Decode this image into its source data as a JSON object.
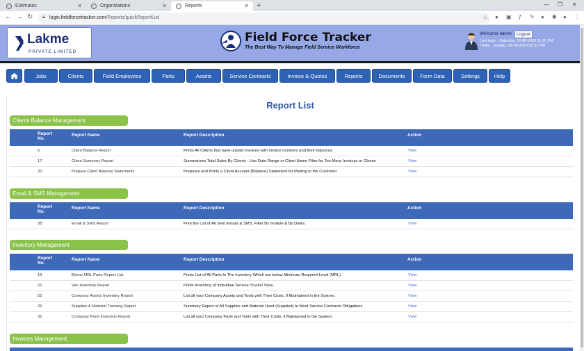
{
  "browser": {
    "tabs": [
      {
        "label": "Estimates",
        "active": false
      },
      {
        "label": "Organizations",
        "active": false
      },
      {
        "label": "Reports",
        "active": true
      }
    ],
    "new_tab": "+",
    "url_host": "login.fieldforcetracker.com",
    "url_path": "/Reports/quickReportList"
  },
  "header": {
    "logo_name": "Lakme",
    "logo_sub": "PRIVATE LIMITED",
    "brand_title": "Field Force Tracker",
    "brand_tagline": "The Best Way To Manage Field Service Workforce",
    "welcome": "Welcome lakme",
    "logout": "Logout",
    "last_login": "Last login : Saturday, 08-08-2020 11:10 PM",
    "today": "Today : Sunday, 08-09-2020 06:51 PM"
  },
  "nav": {
    "items": [
      "Jobs",
      "Clients",
      "Field Employees",
      "Parts",
      "Assets",
      "Service Contracts",
      "Invoice & Quotes",
      "Reports",
      "Documents",
      "Form Data",
      "Settings",
      "Help"
    ]
  },
  "page": {
    "title": "Report List",
    "columns": {
      "no": "Report No.",
      "name": "Report Name",
      "desc": "Report Description",
      "action": "Action"
    },
    "view_label": "View"
  },
  "sections": [
    {
      "title": "Clients Balance Management",
      "rows": [
        {
          "no": "6",
          "name": "Client Balance Report",
          "desc": "Prints All Clients that have unpaid invoices with invoice numbers and their balances."
        },
        {
          "no": "17",
          "name": "Client Summary Report",
          "desc": "Summarizes Total Sales By Clients - Use Date Range or Client Name Filter for Too Many Invoices or Clients"
        },
        {
          "no": "20",
          "name": "Prepare Client Balance Statements",
          "desc": "Prepares and Prints a Client Account (Balance) Statement for Mailing to the Customer."
        }
      ]
    },
    {
      "title": "Email & SMS Management",
      "rows": [
        {
          "no": "38",
          "name": "Email & SMS Report",
          "desc": "Print the List of All Sent Emails & SMS. Filter By module & By Dates."
        }
      ]
    },
    {
      "title": "Inventory Management",
      "rows": [
        {
          "no": "19",
          "name": "Below MRL Parts Report List",
          "desc": "Prints List of All Parts In The Inventory Which are below Minimum Required Level (MRL)."
        },
        {
          "no": "21",
          "name": "Van Inventory Report",
          "desc": "Prints Inventory of Individual Service Trucks/ Vans."
        },
        {
          "no": "22",
          "name": "Company Assets Inventory Report",
          "desc": "List all your Company Assets and Tools with Their Costs, if Maintained in the System."
        },
        {
          "no": "26",
          "name": "Supplies & Material Tracking Report",
          "desc": "Summary Report of All Supplies and Material Used (Supplied) to Meet Service Contracts Obligations"
        },
        {
          "no": "32",
          "name": "Company Parts Inventory Report",
          "desc": "List all your Company Parts and Tools with Their Costs, if Maintained in the System."
        }
      ]
    },
    {
      "title": "Invoices Management",
      "rows": []
    }
  ]
}
